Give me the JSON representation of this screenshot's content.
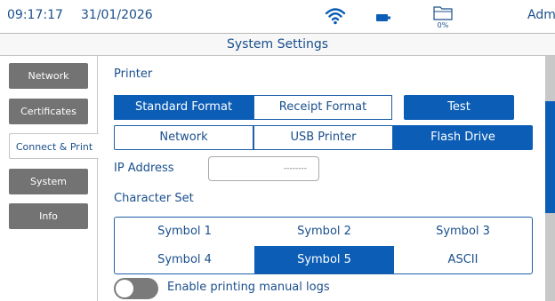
{
  "status": {
    "time": "09:17:17",
    "date": "31/01/2026",
    "wifi_icon": "wifi-icon",
    "battery_icon": "battery-icon",
    "storage_icon": "folder-icon",
    "storage_percent": "0%",
    "user": "Admin"
  },
  "title": "System Settings",
  "sidebar": {
    "items": [
      {
        "label": "Network",
        "active": false
      },
      {
        "label": "Certificates",
        "active": false
      },
      {
        "label": "Connect & Print",
        "active": true
      },
      {
        "label": "System",
        "active": false
      },
      {
        "label": "Info",
        "active": false
      }
    ]
  },
  "printer": {
    "section_label": "Printer",
    "format": {
      "standard": "Standard Format",
      "receipt": "Receipt Format",
      "selected": "Standard Format"
    },
    "test_button": "Test",
    "output": {
      "network": "Network",
      "usb": "USB Printer",
      "flash": "Flash Drive",
      "selected": "Flash Drive"
    },
    "ip_label": "IP Address",
    "ip_placeholder": "--------",
    "charset_label": "Character Set",
    "charsets": [
      "Symbol 1",
      "Symbol 2",
      "Symbol 3",
      "Symbol 4",
      "Symbol 5",
      "ASCII"
    ],
    "charset_selected": "Symbol 5",
    "manual_logs_label": "Enable printing manual logs",
    "manual_logs_enabled": false
  },
  "colors": {
    "accent": "#0b5db5",
    "text": "#1a4f8c",
    "tab_inactive": "#737373"
  }
}
